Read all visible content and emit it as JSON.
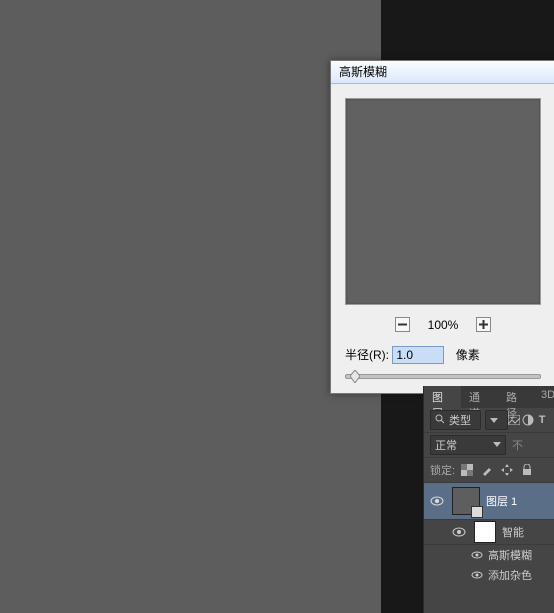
{
  "dialog": {
    "title": "高斯模糊",
    "zoom_out_icon": "minus",
    "zoom_in_icon": "plus",
    "zoom_pct": "100%",
    "radius_label": "半径(R):",
    "radius_value": "1.0",
    "radius_unit": "像素"
  },
  "panel": {
    "tabs": {
      "layers": "图层",
      "channels": "通道",
      "paths": "路径",
      "threeD": "3D"
    },
    "kind_label": "类型",
    "blend_mode": "正常",
    "opacity_label": "不",
    "lock_label": "锁定:",
    "layer": {
      "name": "图层 1"
    },
    "smart": {
      "label": "智能"
    },
    "filters": {
      "gaussian": "高斯模糊",
      "addnoise": "添加杂色"
    }
  }
}
